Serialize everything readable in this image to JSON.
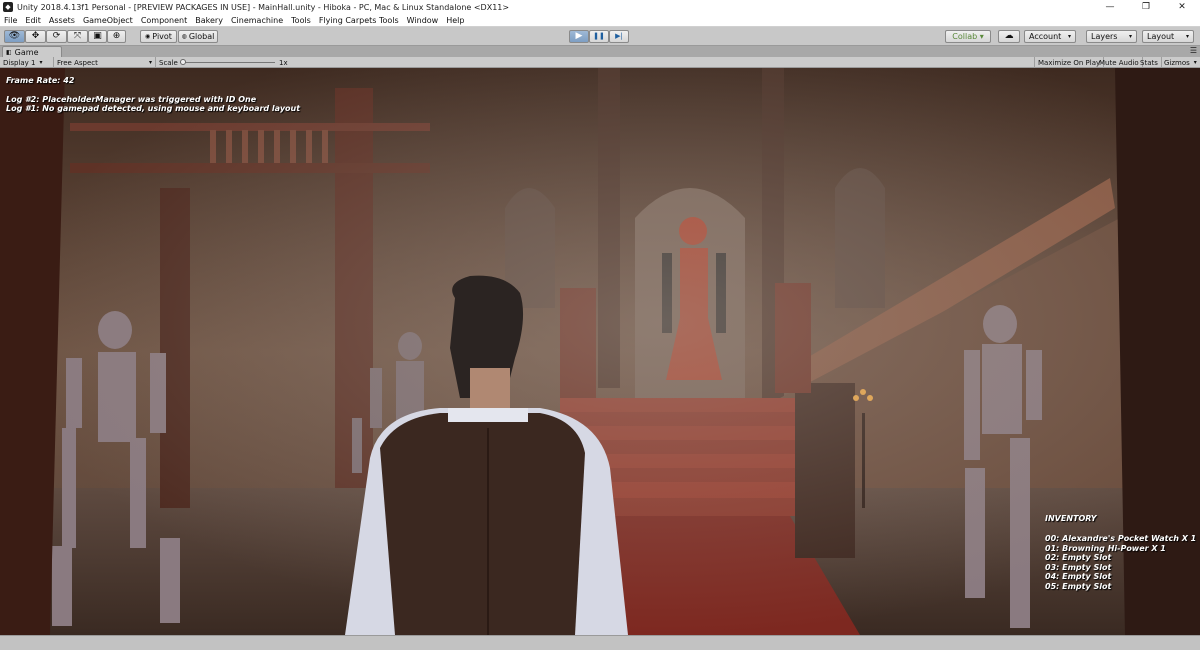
{
  "window": {
    "title": "Unity 2018.4.13f1 Personal - [PREVIEW PACKAGES IN USE] - MainHall.unity - Hiboka - PC, Mac & Linux Standalone <DX11>",
    "minimize_glyph": "—",
    "maximize_glyph": "❐",
    "close_glyph": "✕"
  },
  "menu": [
    "File",
    "Edit",
    "Assets",
    "GameObject",
    "Component",
    "Bakery",
    "Cinemachine",
    "Tools",
    "Flying Carpets Tools",
    "Window",
    "Help"
  ],
  "toolbar": {
    "tools": [
      {
        "icon": "hand-eye-icon",
        "glyph": "👁"
      },
      {
        "icon": "move-icon",
        "glyph": "✥"
      },
      {
        "icon": "rotate-icon",
        "glyph": "⟳"
      },
      {
        "icon": "scale-icon",
        "glyph": "⤧"
      },
      {
        "icon": "rect-tool-icon",
        "glyph": "▣"
      },
      {
        "icon": "transform-tool-icon",
        "glyph": "⊕"
      }
    ],
    "pivot_label": "Pivot",
    "global_label": "Global",
    "play_glyph": "▶",
    "pause_glyph": "❚❚",
    "step_glyph": "▶|",
    "collab_label": "Collab ▾",
    "cloud_glyph": "☁",
    "account_label": "Account",
    "layers_label": "Layers",
    "layout_label": "Layout"
  },
  "game_tab": {
    "label": "Game",
    "display": "Display 1",
    "aspect": "Free Aspect",
    "scale_label": "Scale",
    "scale_value": "1x",
    "maximize_on_play": "Maximize On Play",
    "mute_audio": "Mute Audio",
    "stats": "Stats",
    "gizmos": "Gizmos"
  },
  "hud": {
    "frame_rate": "Frame Rate: 42",
    "log2": "Log #2: PlaceholderManager was triggered with ID One",
    "log1": "Log #1: No gamepad detected, using mouse and keyboard layout"
  },
  "inventory": {
    "title": "INVENTORY",
    "items": [
      "00: Alexandre's Pocket Watch X 1",
      "01: Browning Hi-Power X 1",
      "02: Empty Slot",
      "03: Empty Slot",
      "04: Empty Slot",
      "05: Empty Slot"
    ]
  },
  "colors": {
    "play_active": "#7d9ec3",
    "scene_wall": "#6b4a39",
    "carpet": "#8b2a22",
    "robot": "#8a7a80",
    "figure_red": "#b4432e"
  }
}
